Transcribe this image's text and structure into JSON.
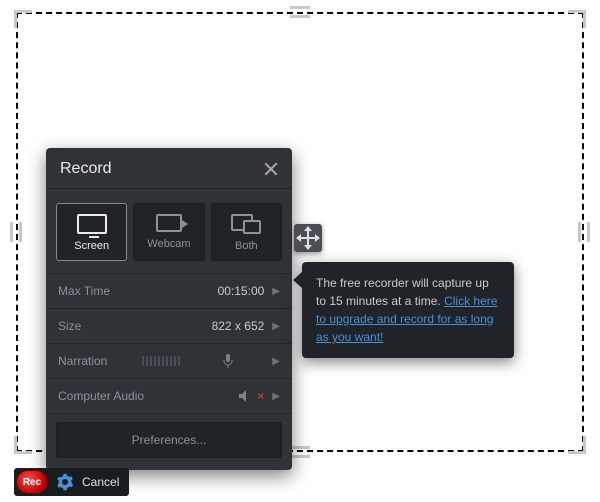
{
  "panel": {
    "title": "Record",
    "sources": {
      "screen": "Screen",
      "webcam": "Webcam",
      "both": "Both",
      "selected": "screen"
    },
    "options": {
      "max_time": {
        "label": "Max Time",
        "value": "00:15:00"
      },
      "size": {
        "label": "Size",
        "value": "822 x 652"
      },
      "narration": {
        "label": "Narration"
      },
      "computer_audio": {
        "label": "Computer Audio",
        "muted": true
      }
    },
    "preferences": "Preferences..."
  },
  "tooltip": {
    "line1": "The free recorder will capture up to 15 minutes at a time.",
    "link": "Click here to upgrade and record for as long as you want!"
  },
  "toolbar": {
    "rec": "Rec",
    "cancel": "Cancel"
  }
}
